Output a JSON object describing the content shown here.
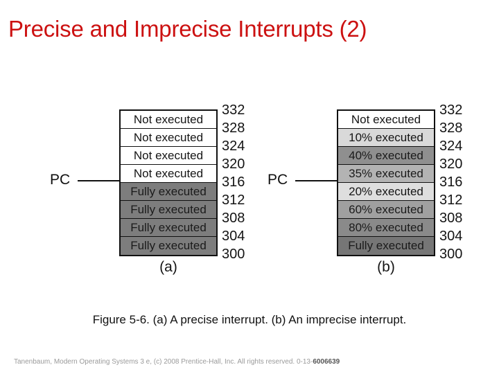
{
  "slide": {
    "title": "Precise and Imprecise Interrupts (2)",
    "title_color": "#cc1111",
    "caption": "Figure 5-6. (a) A precise interrupt. (b) An imprecise interrupt.",
    "footer_text": "Tanenbaum, Modern Operating Systems 3 e, (c) 2008 Prentice-Hall, Inc. All rights reserved. 0-13-",
    "footer_isbn": "6006639"
  },
  "panels": [
    {
      "id": "a",
      "label": "(a)",
      "pointer_label": "PC",
      "pointer_row_index": 4,
      "rows": [
        {
          "text": "Not executed",
          "fill": "#ffffff",
          "text_color": "#141414"
        },
        {
          "text": "Not executed",
          "fill": "#ffffff",
          "text_color": "#141414"
        },
        {
          "text": "Not executed",
          "fill": "#ffffff",
          "text_color": "#141414"
        },
        {
          "text": "Not executed",
          "fill": "#ffffff",
          "text_color": "#141414"
        },
        {
          "text": "Fully executed",
          "fill": "#7d7d7d",
          "text_color": "#1a1a1a"
        },
        {
          "text": "Fully executed",
          "fill": "#7d7d7d",
          "text_color": "#1a1a1a"
        },
        {
          "text": "Fully executed",
          "fill": "#7d7d7d",
          "text_color": "#1a1a1a"
        },
        {
          "text": "Fully executed",
          "fill": "#7d7d7d",
          "text_color": "#1a1a1a"
        }
      ],
      "addresses": [
        "332",
        "328",
        "324",
        "320",
        "316",
        "312",
        "308",
        "304",
        "300"
      ]
    },
    {
      "id": "b",
      "label": "(b)",
      "pointer_label": "PC",
      "pointer_row_index": 4,
      "rows": [
        {
          "text": "Not executed",
          "fill": "#ffffff",
          "text_color": "#141414"
        },
        {
          "text": "10% executed",
          "fill": "#d9d9d9",
          "text_color": "#141414"
        },
        {
          "text": "40% executed",
          "fill": "#8f8f8f",
          "text_color": "#1a1a1a"
        },
        {
          "text": "35% executed",
          "fill": "#b3b3b3",
          "text_color": "#1a1a1a"
        },
        {
          "text": "20% executed",
          "fill": "#dedede",
          "text_color": "#141414"
        },
        {
          "text": "60% executed",
          "fill": "#a0a0a0",
          "text_color": "#1a1a1a"
        },
        {
          "text": "80% executed",
          "fill": "#8a8a8a",
          "text_color": "#1a1a1a"
        },
        {
          "text": "Fully executed",
          "fill": "#767676",
          "text_color": "#1a1a1a"
        }
      ],
      "addresses": [
        "332",
        "328",
        "324",
        "320",
        "316",
        "312",
        "308",
        "304",
        "300"
      ]
    }
  ]
}
